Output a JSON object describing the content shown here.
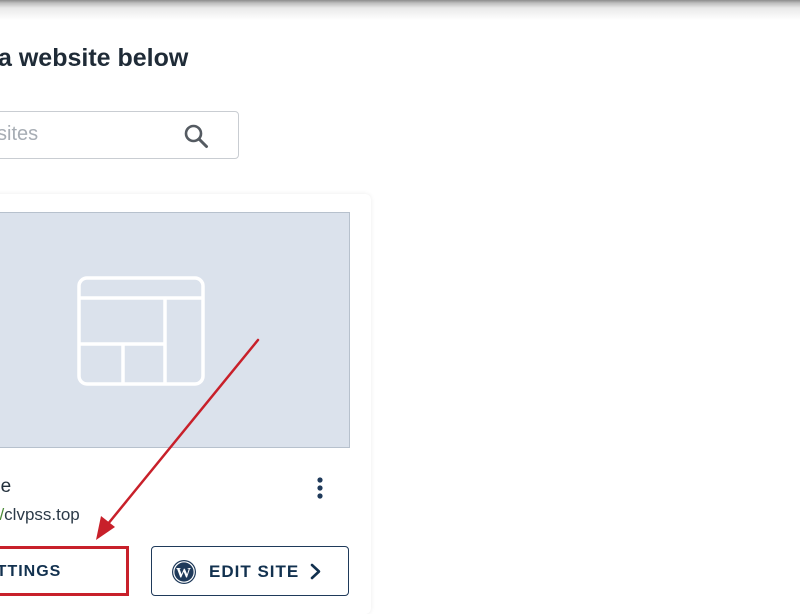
{
  "page": {
    "heading": "a website below"
  },
  "search": {
    "placeholder": "sites",
    "icon": "search-icon"
  },
  "site_card": {
    "thumbnail_icon": "website-layout-icon",
    "name": "ne",
    "url_prefix": "://",
    "url_host": "clvpss.top",
    "menu_icon": "kebab-menu-icon",
    "settings_label": "ETTINGS",
    "edit_label": "EDIT SITE",
    "edit_icon": "wordpress-icon",
    "edit_chevron": "chevron-right-icon"
  },
  "colors": {
    "highlight": "#c8202a",
    "navy": "#12314f",
    "thumbnail_bg": "#dbe2ec",
    "url_prefix": "#4c8a3a"
  }
}
